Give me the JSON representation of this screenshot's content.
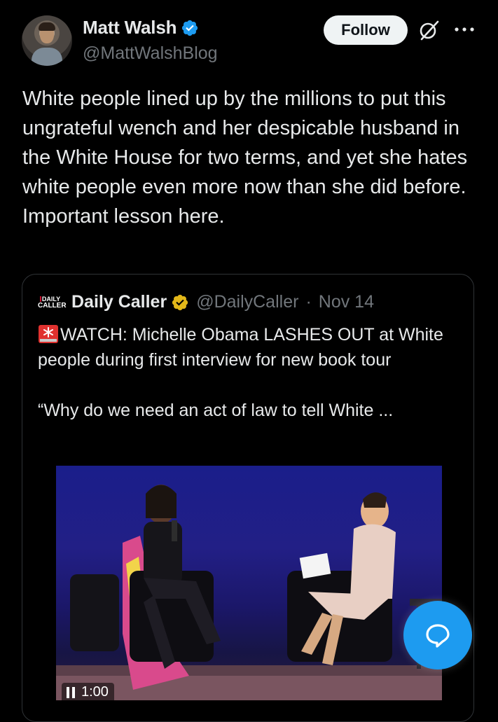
{
  "author": {
    "display_name": "Matt Walsh",
    "handle": "@MattWalshBlog",
    "verified": true,
    "verified_color": "#1d9bf0"
  },
  "actions": {
    "follow_label": "Follow",
    "grok_icon": "grok-icon",
    "more_icon": "more-horizontal-icon"
  },
  "tweet": {
    "text": "White people lined up by the millions to put this ungrateful wench and her despicable husband in the White House for two terms, and yet she hates white people even more now than she did before. Important lesson here."
  },
  "quote": {
    "logo_line1": "DAILY",
    "logo_line2": "CALLER",
    "display_name": "Daily Caller",
    "verified_badge": "gold",
    "verified_color": "#e2b719",
    "handle": "@DailyCaller",
    "separator": "·",
    "date": "Nov 14",
    "text_emoji": "rotating-light-icon",
    "text_line": "WATCH: Michelle Obama LASHES OUT at White people during first interview for new book tour",
    "text_excerpt": "“Why do we need an act of law to tell White ..."
  },
  "video": {
    "timer": "1:00",
    "state_icon": "pause-icon"
  },
  "fab": {
    "icon": "compose-reply-icon",
    "color": "#1d9bf0"
  }
}
